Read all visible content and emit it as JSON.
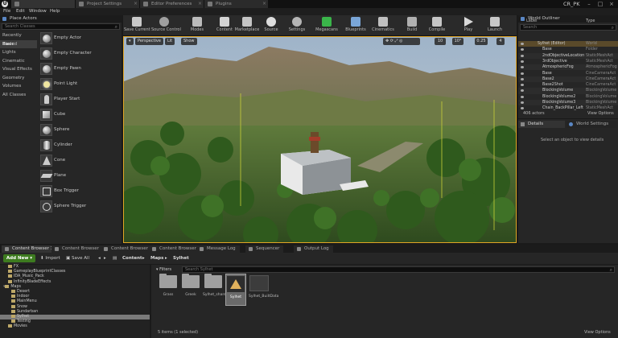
{
  "window": {
    "logo": "U",
    "project_name": "CR_PK",
    "tabs": [
      "",
      "Project Settings",
      "Editor Preferences",
      "Plugins"
    ],
    "controls": [
      "–",
      "□",
      "×"
    ]
  },
  "menu": [
    "File",
    "Edit",
    "Window",
    "Help"
  ],
  "place_actors": {
    "title": "Place Actors",
    "search_placeholder": "Search Classes",
    "categories": [
      "Recently Placed",
      "Basic",
      "Lights",
      "Cinematic",
      "Visual Effects",
      "Geometry",
      "Volumes",
      "All Classes"
    ],
    "selected_category": "Basic",
    "actors": [
      "Empty Actor",
      "Empty Character",
      "Empty Pawn",
      "Point Light",
      "Player Start",
      "Cube",
      "Sphere",
      "Cylinder",
      "Cone",
      "Plane",
      "Box Trigger",
      "Sphere Trigger"
    ]
  },
  "toolbar": {
    "buttons": [
      "Save Current",
      "Source Control",
      "Modes",
      "Content",
      "Marketplace",
      "Source",
      "Settings",
      "Megascans",
      "Blueprints",
      "Cinematics",
      "Build",
      "Compile",
      "Play",
      "Launch"
    ]
  },
  "viewport": {
    "perspective": "Perspective",
    "lit": "Lit",
    "show": "Show",
    "grid_snap": "10",
    "rot_snap": "10°",
    "scale_snap": "0.25",
    "cam_speed": "4"
  },
  "outliner": {
    "title": "World Outliner",
    "search_placeholder": "Search",
    "col_label": "Label",
    "col_type": "Type",
    "rows": [
      {
        "label": "Sylhet (Editor)",
        "type": "World"
      },
      {
        "label": "Base",
        "type": "Folder"
      },
      {
        "label": "2ndObjectiveLocation",
        "type": "StaticMeshAct"
      },
      {
        "label": "3rdObjective",
        "type": "StaticMeshAct"
      },
      {
        "label": "AtmosphericFog",
        "type": "AtmosphericFog"
      },
      {
        "label": "Base",
        "type": "CineCameraAct"
      },
      {
        "label": "Base2",
        "type": "CineCameraAct"
      },
      {
        "label": "Base2Shot",
        "type": "CineCameraAct"
      },
      {
        "label": "BlockingVolume",
        "type": "BlockingVolume"
      },
      {
        "label": "BlockingVolume2",
        "type": "BlockingVolume"
      },
      {
        "label": "BlockingVolume3",
        "type": "BlockingVolume"
      },
      {
        "label": "Chain_BackPillar_Left",
        "type": "StaticMeshAct"
      }
    ],
    "actor_count": "406 actors",
    "view_options": "View Options"
  },
  "details": {
    "tab_details": "Details",
    "tab_world": "World Settings",
    "empty_message": "Select an object to view details"
  },
  "bottom_tabs": [
    "Content Browser 1",
    "Content Browser 2",
    "Content Browser 3",
    "Content Browser 4",
    "Message Log",
    "Sequencer",
    "Output Log"
  ],
  "content_browser": {
    "add_new": "Add New",
    "import": "Import",
    "save_all": "Save All",
    "path": [
      "Content",
      "Maps",
      "Sylhet"
    ],
    "search_placeholder": "Search Sylhet",
    "filters": "Filters",
    "tree": [
      {
        "label": "FX",
        "indent": 1
      },
      {
        "label": "GameplayBlueprintClasses",
        "indent": 1
      },
      {
        "label": "IDA_Music_Pack",
        "indent": 1
      },
      {
        "label": "InfinityBladeEffects",
        "indent": 1
      },
      {
        "label": "Maps",
        "indent": 0
      },
      {
        "label": "Desert",
        "indent": 2
      },
      {
        "label": "Indoor",
        "indent": 2
      },
      {
        "label": "MainMenu",
        "indent": 2
      },
      {
        "label": "Snow",
        "indent": 2
      },
      {
        "label": "Sundarban",
        "indent": 2
      },
      {
        "label": "Sylhet",
        "indent": 2
      },
      {
        "label": "Testing",
        "indent": 2
      },
      {
        "label": "Movies",
        "indent": 1
      }
    ],
    "selected_tree": "Sylhet",
    "assets": [
      "Grass",
      "Greek",
      "Sylhet_sharedassets",
      "Sylhet",
      "Sylhet_BuiltData"
    ],
    "selection_status": "5 items (1 selected)",
    "view_options": "View Options"
  }
}
